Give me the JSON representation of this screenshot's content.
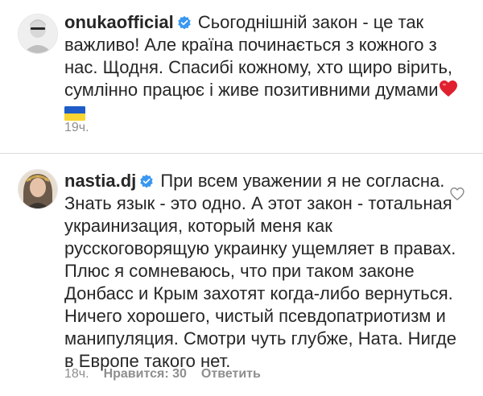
{
  "comments": [
    {
      "username": "onukaofficial",
      "verified": true,
      "text": "Сьогоднішній закон - це так важливо! Але країна починається з кожного з нас. Щодня. Спасибі кожному, хто щиро вірить, сумлінно працює і живе позитивними думами",
      "emojis": [
        "heart-emoji",
        "ukraine-flag-emoji"
      ],
      "time": "19ч."
    },
    {
      "username": "nastia.dj",
      "verified": true,
      "text": "При всем уважении я не согласна. Знать язык - это одно. А этот закон - тотальная украинизация, который меня как русскоговорящую украинку ущемляет в правах. Плюс я сомневаюсь, что при таком законе Донбасс и Крым захотят когда-либо вернуться. Ничего хорошего, чистый псевдопатриотизм и манипуляция. Смотри чуть глубже, Ната. Нигде в Европе такого нет.",
      "time": "18ч.",
      "likes": "Нравится: 30",
      "reply": "Ответить"
    }
  ],
  "colors": {
    "text": "#262626",
    "meta": "#8e8e8e",
    "verified": "#3897f0",
    "divider": "#dbdbdb"
  }
}
